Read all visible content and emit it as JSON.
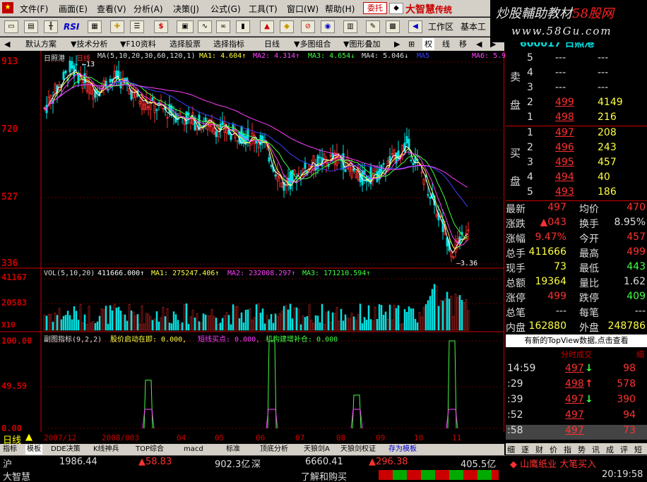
{
  "menubar": {
    "items": [
      "文件(F)",
      "画面(E)",
      "查看(V)",
      "分析(A)",
      "决策(J)",
      "公式(G)",
      "工具(T)",
      "窗口(W)",
      "帮助(H)"
    ],
    "weituo": "委托",
    "brand": "大智慧",
    "brand_suffix": "传统"
  },
  "watermark": {
    "line1_a": "炒股輔助教材",
    "line1_b": "58股网",
    "line2": "www.58Gu.com"
  },
  "toolbar": {
    "rsi": "RSI",
    "workspace": "工作区",
    "basic": "基本工"
  },
  "tabs": {
    "default_scheme": "默认方案",
    "tech": "技术分析",
    "f10": "F10资料",
    "pick": "选择股票",
    "pick_indicator": "选择指标",
    "period": "日线",
    "multi": "多图组合",
    "overlay": "图形叠加",
    "quan": "权",
    "xian": "线",
    "move": "移"
  },
  "stock": {
    "code": "600017",
    "name": "日照港"
  },
  "main_chart": {
    "title": "日照港",
    "period": "日线",
    "ma_label": "MA(5,10,20,30,60,120,1)",
    "ma1": "MA1: 4.604↑",
    "ma2": "MA2: 4.314↑",
    "ma3": "MA3: 4.654↓",
    "ma4": "MA4: 5.046↓",
    "ma5": "MA5",
    "ma6": "MA6: 5.9",
    "y_ticks": [
      "913",
      "720",
      "527",
      "336"
    ],
    "high_mark": "13",
    "low_mark": "3.36"
  },
  "vol_chart": {
    "label": "VOL(5,10,20)",
    "value": "411666.000↑",
    "ma1": "MA1: 275247.406↑",
    "ma2": "MA2: 232008.297↑",
    "ma3": "MA3: 171210.594↑",
    "y_ticks": [
      "41167",
      "20583"
    ],
    "unit": "X10"
  },
  "sub_chart": {
    "label": "副图指标(9,2,2)",
    "l1": "股价启动在即: 0.000,",
    "l2": "短线买点: 0.000,",
    "l3": "机构建增补仓: 0.000",
    "y_ticks": [
      "100.00",
      "49.59",
      "0.00"
    ]
  },
  "x_axis": [
    "2007/12",
    "2008/003",
    "04",
    "05",
    "06",
    "07",
    "08",
    "09",
    "10",
    "11"
  ],
  "bottom_tabs": [
    "指标",
    "模板",
    "DDE决策",
    "K线神兵",
    "TOP综合",
    "macd",
    "标准",
    "顶底分析",
    "天狼剑A",
    "天狼剑权证",
    "存为模板"
  ],
  "period_label": "日线",
  "order_book": {
    "sell": [
      {
        "n": "5",
        "p": "---",
        "v": "---"
      },
      {
        "n": "4",
        "p": "---",
        "v": "---"
      },
      {
        "n": "3",
        "p": "---",
        "v": "---"
      },
      {
        "n": "2",
        "p": "499",
        "v": "4149"
      },
      {
        "n": "1",
        "p": "498",
        "v": "216"
      }
    ],
    "buy": [
      {
        "n": "1",
        "p": "497",
        "v": "208"
      },
      {
        "n": "2",
        "p": "496",
        "v": "243"
      },
      {
        "n": "3",
        "p": "495",
        "v": "457"
      },
      {
        "n": "4",
        "p": "494",
        "v": "40"
      },
      {
        "n": "5",
        "p": "493",
        "v": "186"
      }
    ],
    "sell_label": [
      "卖",
      "盘"
    ],
    "buy_label": [
      "买",
      "盘"
    ]
  },
  "quote": [
    {
      "k1": "最新",
      "v1": "497",
      "k2": "均价",
      "v2": "470"
    },
    {
      "k1": "涨跌",
      "v1": "▲043",
      "k2": "换手",
      "v2": "8.95%"
    },
    {
      "k1": "涨幅",
      "v1": "9.47%",
      "k2": "今开",
      "v2": "457"
    },
    {
      "k1": "总手",
      "v1": "411666",
      "k2": "最高",
      "v2": "499"
    },
    {
      "k1": "现手",
      "v1": "73",
      "k2": "最低",
      "v2": "443"
    },
    {
      "k1": "总额",
      "v1": "19364",
      "k2": "量比",
      "v2": "1.62"
    },
    {
      "k1": "涨停",
      "v1": "499",
      "k2": "跌停",
      "v2": "409"
    },
    {
      "k1": "总笔",
      "v1": "---",
      "k2": "每笔",
      "v2": "---"
    },
    {
      "k1": "内盘",
      "v1": "162880",
      "k2": "外盘",
      "v2": "248786"
    }
  ],
  "topview": "有新的TopView数据,点击查看",
  "ticks": {
    "header": "分时成交",
    "header_right": "细",
    "rows": [
      {
        "t": "14:59",
        "p": "497",
        "d": "↓",
        "v": "98"
      },
      {
        "t": ":29",
        "p": "498",
        "d": "↑",
        "v": "578"
      },
      {
        "t": ":39",
        "p": "497",
        "d": "↓",
        "v": "390"
      },
      {
        "t": ":52",
        "p": "497",
        "d": "",
        "v": "94"
      },
      {
        "t": ":58",
        "p": "497",
        "d": "",
        "v": "73"
      }
    ]
  },
  "right_tabs": [
    "细",
    "逐",
    "财",
    "价",
    "指",
    "势",
    "讯",
    "成",
    "评",
    "短"
  ],
  "status": {
    "sh_label": "沪",
    "sh_index": "1986.44",
    "sh_change": "▲58.83",
    "sh_amount": "902.3亿",
    "sz_label": "深",
    "sz_index": "6660.41",
    "sz_change": "▲296.38",
    "sz_amount": "405.5亿",
    "news": "◆ 山鹰纸业 大笔买入",
    "brand": "大智慧",
    "hint": "了解和购买",
    "time": "20:19:58"
  }
}
